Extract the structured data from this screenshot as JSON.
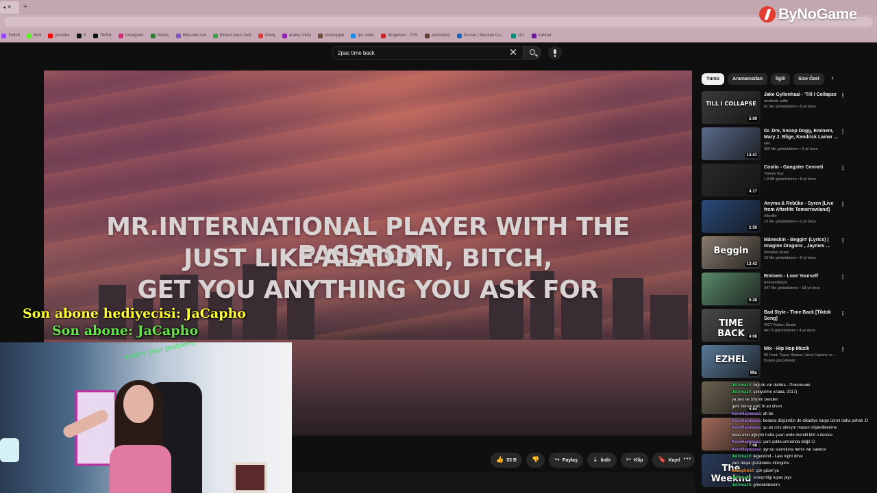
{
  "browser": {
    "bookmarks": [
      {
        "label": "Twitch",
        "color": "#9146ff"
      },
      {
        "label": "Kick",
        "color": "#53fc18"
      },
      {
        "label": "youtube",
        "color": "#ff0000"
      },
      {
        "label": "X",
        "color": "#111111"
      },
      {
        "label": "TikTok",
        "color": "#111111"
      },
      {
        "label": "Instagram",
        "color": "#d62976"
      },
      {
        "label": "Sodos",
        "color": "#2e7d32"
      },
      {
        "label": "Minashio bot",
        "color": "#7e57c2"
      },
      {
        "label": "Kicklet yayın indir",
        "color": "#43a047"
      },
      {
        "label": "bitenj",
        "color": "#e53935"
      },
      {
        "label": "arabia nikita",
        "color": "#8e24aa"
      },
      {
        "label": "kisshoppie",
        "color": "#6d4c41"
      },
      {
        "label": "fps siteki",
        "color": "#1e88e5"
      },
      {
        "label": "Vergeister - TPS",
        "color": "#c62828"
      },
      {
        "label": "askisodoq",
        "color": "#5d4037"
      },
      {
        "label": "Soccer | Mackan Ca...",
        "color": "#1565c0"
      },
      {
        "label": "101",
        "color": "#00897b"
      },
      {
        "label": "kaliktat",
        "color": "#6a1b9a"
      }
    ],
    "brand": "ByNoGame"
  },
  "header": {
    "search_value": "2pac time back",
    "clear_glyph": "✕"
  },
  "video": {
    "lyrics": [
      "MR.INTERNATIONAL PLAYER WITH THE PASSPORT",
      "JUST LIKE ALADDIN, BITCH,",
      "GET YOU ANYTHING YOU ASK FOR"
    ]
  },
  "overlay": {
    "gifter": "Son abone hediyecisi: JaCapho",
    "subscriber": "Son abone: JaCapho",
    "webcam_note": "what's your problem?"
  },
  "actions": {
    "like": "53 B",
    "share": "Paylaş",
    "download": "İndir",
    "clip": "Klip",
    "save": "Kaydet",
    "more": "···"
  },
  "chips": [
    "Tümü",
    "Aramanızdan",
    "İlgili",
    "Size Özel"
  ],
  "recommendations": [
    {
      "title": "Jake Gyllenhaal - 'Till I Collapse",
      "channel": "aesthetic edits",
      "meta": "81 Mn görüntüleme • 8 yıl önce",
      "duration": "5:00",
      "thumb_text": "TILL I COLLAPSE",
      "bg": "#3a3a3a"
    },
    {
      "title": "Dr. Dre, Snoop Dogg, Eminem, Mary J. Blige, Kendrick Lamar ...",
      "channel": "NFL",
      "meta": "360 Mn görüntüleme • 3 yıl önce",
      "duration": "14:41",
      "thumb_text": "",
      "bg": "#5a6a8a"
    },
    {
      "title": "Coolio - Gangster Cenneti",
      "channel": "Tommy Boy",
      "meta": "1,8 Mr görüntüleme • 8 yıl önce",
      "duration": "4:17",
      "thumb_text": "",
      "bg": "#2a2a2a"
    },
    {
      "title": "Anyma & Rebūke - Syren [Live from Afterlife Tomorrowland]",
      "channel": "Afterlife",
      "meta": "15 Mn görüntüleme • 2 yıl önce",
      "duration": "2:50",
      "thumb_text": "",
      "bg": "#2a4a7a"
    },
    {
      "title": "Måneskin - Beggin' (Lyrics) | Imagine Dragons , Jaymes ...",
      "channel": "Monstas Music",
      "meta": "15 Mn görüntüleme • 2 yıl önce",
      "duration": "13:43",
      "thumb_text": "Beggin",
      "bg": "#8a7c70"
    },
    {
      "title": "Eminem - Lose Yourself",
      "channel": "EminemMusic",
      "meta": "247 Mn görüntüleme • 18 yıl önce",
      "duration": "5:28",
      "thumb_text": "",
      "bg": "#5a8a6a"
    },
    {
      "title": "Bad Style - Time Back [Tiktok Song]",
      "channel": "WCY Nation Studio",
      "meta": "441 B görüntüleme • 4 yıl önce",
      "duration": "4:06",
      "thumb_text": "TIME BACK",
      "bg": "#4a4a4a"
    },
    {
      "title": "Mix - Hip Hop Müzik",
      "channel": "50 Cent, Tupac Shakur, Umut Capone ve ...",
      "meta": "Bugün güncellendi",
      "duration": "Mix",
      "thumb_text": "EZHEL",
      "bg": "#5a7a9a"
    },
    {
      "title": "",
      "channel": "",
      "meta": "",
      "duration": "5:54",
      "thumb_text": "",
      "bg": "#6a6050"
    },
    {
      "title": "",
      "channel": "",
      "meta": "",
      "duration": "7:08",
      "thumb_text": "",
      "bg": "#a06a5a"
    },
    {
      "title": "",
      "channel": "",
      "meta": "",
      "duration": "",
      "thumb_text": "The Weeknd",
      "bg": "#2a3a5a"
    }
  ],
  "chat": [
    {
      "user": "JeDima10",
      "text": ": bigi de var dedida - Поколение",
      "color": "#33e066"
    },
    {
      "user": "JeDima10",
      "text": ": çekiyorme хлава, 2017)",
      "color": "#33e066"
    },
    {
      "user": "",
      "text": "ya sen ne izliyom benden",
      "color": "#ffffff"
    },
    {
      "user": "",
      "text": "getir bence epic bi an olsun",
      "color": "#ffffff"
    },
    {
      "user": "KuroHayabusa",
      "text": ": ah be",
      "color": "#bb88ff"
    },
    {
      "user": "KuroHayabusa",
      "text": ": bedava düşündün de dikadiye kargo ücreti daha pahalı :D",
      "color": "#bb88ff"
    },
    {
      "user": "KuroHayabusa",
      "text": ": şu an cılız alınıyor musun söylediklerime",
      "color": "#bb88ff"
    },
    {
      "user": "",
      "text": "heee evet ağlıyım hatta şuan evde mendil bitti o derece",
      "color": "#ffffff"
    },
    {
      "user": "KuroHayabusa",
      "text": ": yani çokta umrumda değil :D",
      "color": "#bb88ff"
    },
    {
      "user": "KuroHayabusa",
      "text": ": ayrısu sounduna remix var sadece",
      "color": "#bb88ff"
    },
    {
      "user": "JeDima10",
      "text": ": legendind - Late night drive",
      "color": "#33e066"
    },
    {
      "user": "",
      "text": "yani deqal güzeldeles #longdriv...",
      "color": "#ffffff"
    },
    {
      "user": "JaCapho10",
      "text": ": çok güzel ya",
      "color": "#ff9933"
    },
    {
      "user": "JeDima10",
      "text": ": snoop bigi tupac jayz",
      "color": "#33e066"
    },
    {
      "user": "JeDima10",
      "text": ": görebildiklerim",
      "color": "#33e066"
    }
  ]
}
